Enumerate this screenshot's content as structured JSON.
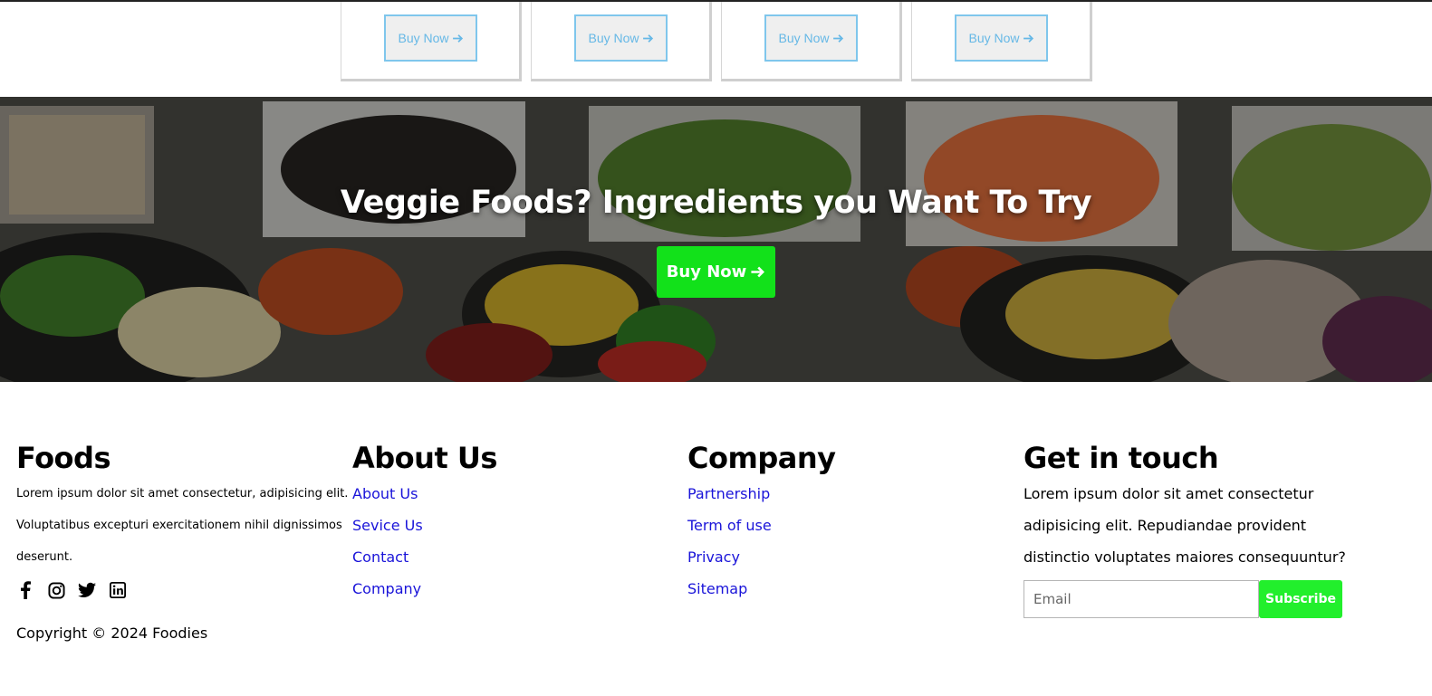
{
  "products": [
    {
      "button_label": "Buy Now",
      "arrow_icon": "arrow-right-icon"
    },
    {
      "button_label": "Buy Now",
      "arrow_icon": "arrow-right-icon"
    },
    {
      "button_label": "Buy Now",
      "arrow_icon": "arrow-right-icon"
    },
    {
      "button_label": "Buy Now",
      "arrow_icon": "arrow-right-icon"
    }
  ],
  "hero": {
    "title": "Veggie Foods? Ingredients you Want To Try",
    "button_label": "Buy Now",
    "button_color": "#12e11a"
  },
  "footer": {
    "foods": {
      "heading": "Foods",
      "text": "Lorem ipsum dolor sit amet consectetur, adipisicing elit. Voluptatibus excepturi exercitationem nihil dignissimos deserunt.",
      "socials": [
        "facebook-icon",
        "instagram-icon",
        "twitter-icon",
        "linkedin-icon"
      ]
    },
    "about": {
      "heading": "About Us",
      "links": [
        "About Us",
        "Sevice Us",
        "Contact",
        "Company"
      ]
    },
    "company": {
      "heading": "Company",
      "links": [
        "Partnership",
        "Term of use",
        "Privacy",
        "Sitemap"
      ]
    },
    "contact": {
      "heading": "Get in touch",
      "text": "Lorem ipsum dolor sit amet consectetur adipisicing elit. Repudiandae provident distinctio voluptates maiores consequuntur?",
      "email_placeholder": "Email",
      "subscribe_label": "Subscribe",
      "subscribe_color": "#22ef2c"
    },
    "copyright": "Copyright © 2024 Foodies",
    "link_color": "#1a14d9"
  }
}
